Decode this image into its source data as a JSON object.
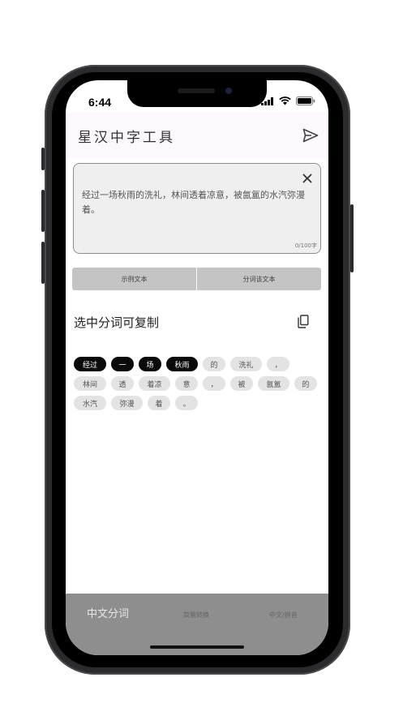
{
  "status": {
    "time": "6:44"
  },
  "app": {
    "title": "星汉中字工具"
  },
  "input": {
    "text": "经过一场秋雨的洗礼，林间透着凉意，被氤氲的水汽弥漫着。",
    "counter": "0/100字"
  },
  "buttons": {
    "sample": "示例文本",
    "segment": "分词该文本"
  },
  "section": {
    "title": "选中分词可复制"
  },
  "tokens": [
    {
      "text": "经过",
      "selected": true
    },
    {
      "text": "一",
      "selected": true
    },
    {
      "text": "场",
      "selected": true
    },
    {
      "text": "秋雨",
      "selected": true
    },
    {
      "text": "的",
      "selected": false
    },
    {
      "text": "洗礼",
      "selected": false
    },
    {
      "text": "，",
      "selected": false
    },
    {
      "text": "林间",
      "selected": false
    },
    {
      "text": "透",
      "selected": false
    },
    {
      "text": "着凉",
      "selected": false
    },
    {
      "text": "意",
      "selected": false
    },
    {
      "text": "，",
      "selected": false
    },
    {
      "text": "被",
      "selected": false
    },
    {
      "text": "氤氲",
      "selected": false
    },
    {
      "text": "的",
      "selected": false
    },
    {
      "text": "水汽",
      "selected": false
    },
    {
      "text": "弥漫",
      "selected": false
    },
    {
      "text": "着",
      "selected": false
    },
    {
      "text": "。",
      "selected": false
    }
  ],
  "tabs": [
    "中文分词",
    "简繁转换",
    "中文/拼音"
  ],
  "icons": {
    "send": "send-icon",
    "clear": "close-icon",
    "copy": "copy-icon",
    "wifi": "wifi-icon",
    "battery": "battery-icon",
    "signal": "signal-icon"
  },
  "colors": {
    "selected_chip": "#0a0a0a",
    "chip": "#e3e3e3",
    "bottom_bar": "#8e8e8e"
  }
}
